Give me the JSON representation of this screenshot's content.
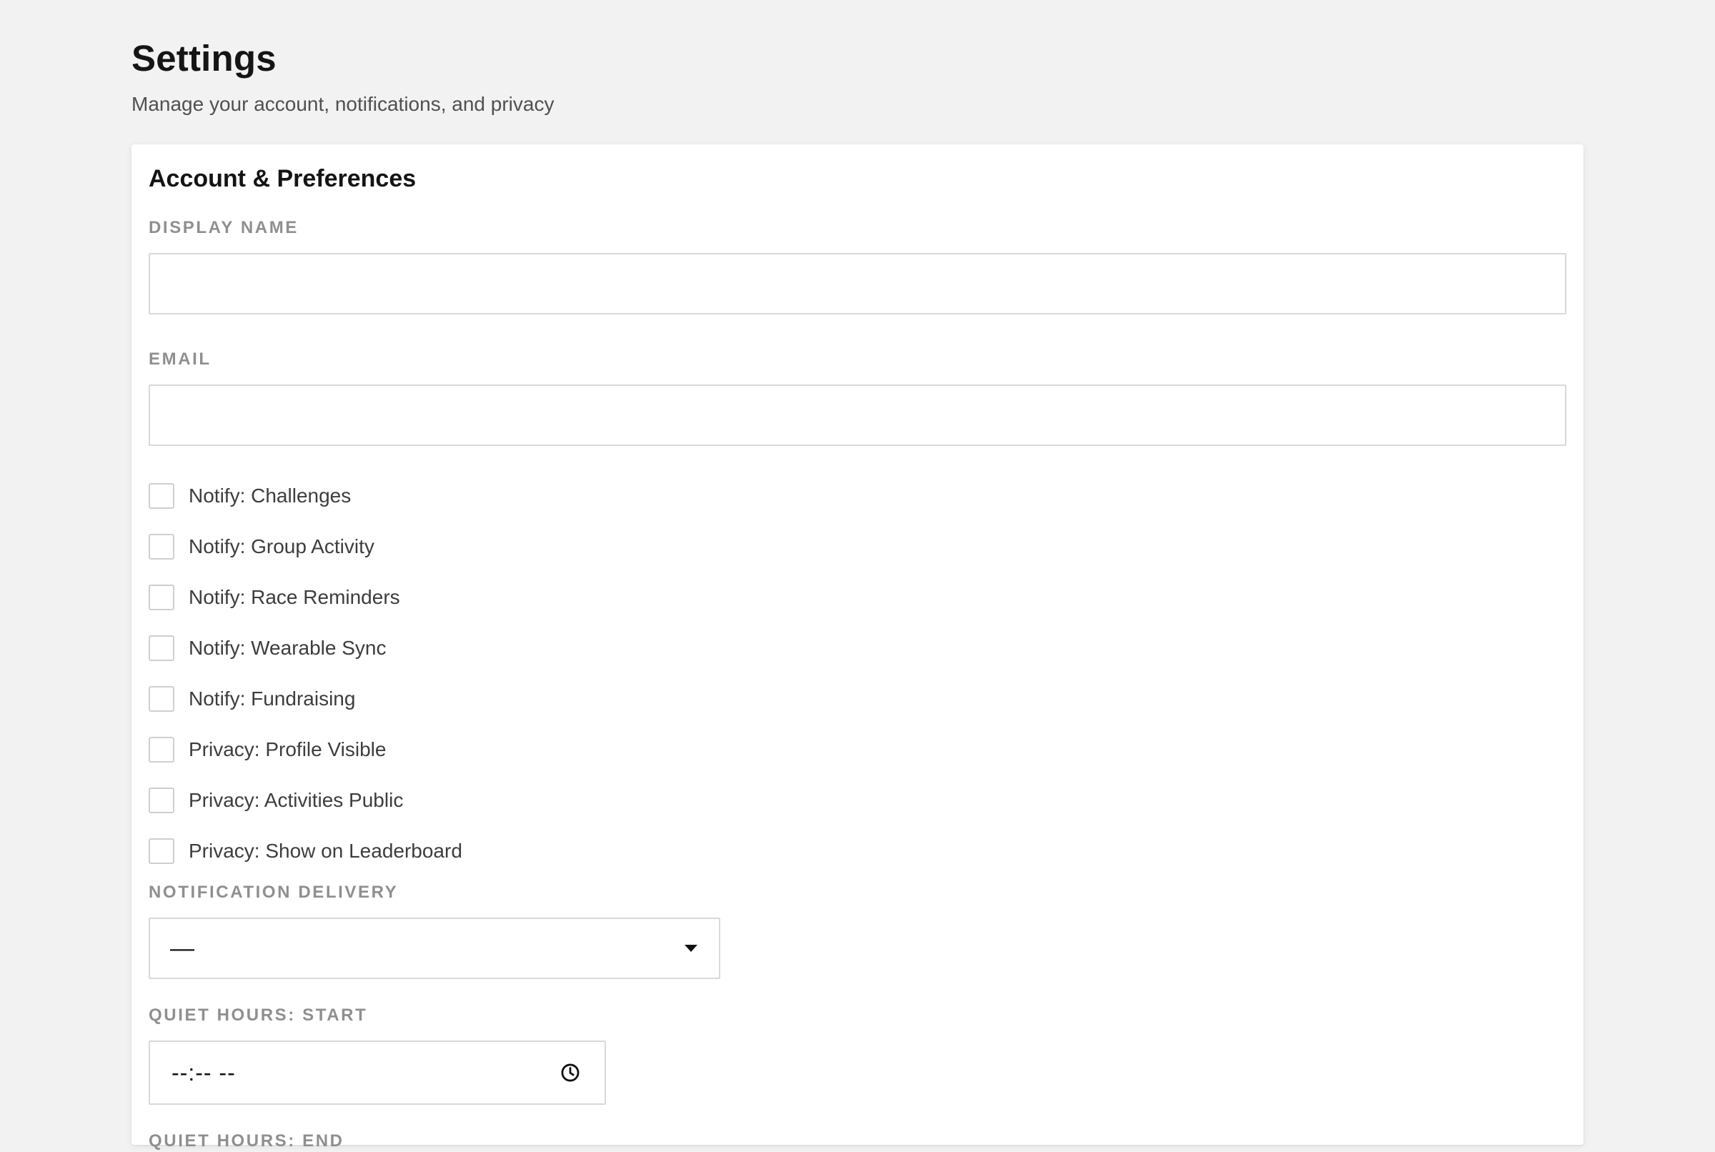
{
  "header": {
    "title": "Settings",
    "subtitle": "Manage your account, notifications, and privacy"
  },
  "card": {
    "title": "Account & Preferences",
    "display_name": {
      "label": "DISPLAY NAME",
      "value": "",
      "placeholder": ""
    },
    "email": {
      "label": "EMAIL",
      "value": "",
      "placeholder": ""
    },
    "checkboxes": [
      {
        "label": "Notify: Challenges",
        "checked": false
      },
      {
        "label": "Notify: Group Activity",
        "checked": false
      },
      {
        "label": "Notify: Race Reminders",
        "checked": false
      },
      {
        "label": "Notify: Wearable Sync",
        "checked": false
      },
      {
        "label": "Notify: Fundraising",
        "checked": false
      },
      {
        "label": "Privacy: Profile Visible",
        "checked": false
      },
      {
        "label": "Privacy: Activities Public",
        "checked": false
      },
      {
        "label": "Privacy: Show on Leaderboard",
        "checked": false
      }
    ],
    "notification_delivery": {
      "label": "NOTIFICATION DELIVERY",
      "selected": "—",
      "icon": "chevron-down-icon"
    },
    "quiet_hours_start": {
      "label": "QUIET HOURS: START",
      "value": "--:-- --",
      "icon": "clock-icon"
    },
    "quiet_hours_end": {
      "label": "QUIET HOURS: END"
    }
  }
}
